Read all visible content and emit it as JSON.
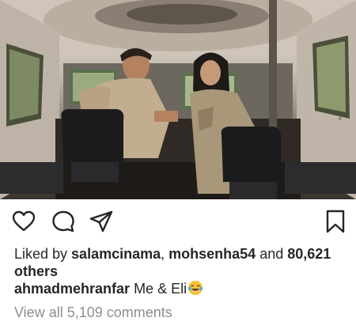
{
  "post": {
    "liked_by_prefix": "Liked by ",
    "liked_user_1": "salamcinama",
    "separator": ", ",
    "liked_user_2": "mohsenha54",
    "and_text": " and ",
    "others_count": "80,621",
    "others_label": " others",
    "caption_user": "ahmadmehranfar",
    "caption_text": " Me & Eli",
    "caption_emoji": "face-with-tears-of-joy-icon",
    "view_comments": "View all 5,109 comments"
  },
  "colors": {
    "text": "#262626",
    "muted": "#8e8e8e",
    "emoji_yellow": "#f7c236",
    "emoji_tears": "#5aa9e6"
  },
  "icons": [
    "heart-icon",
    "comment-icon",
    "share-icon",
    "bookmark-icon"
  ]
}
